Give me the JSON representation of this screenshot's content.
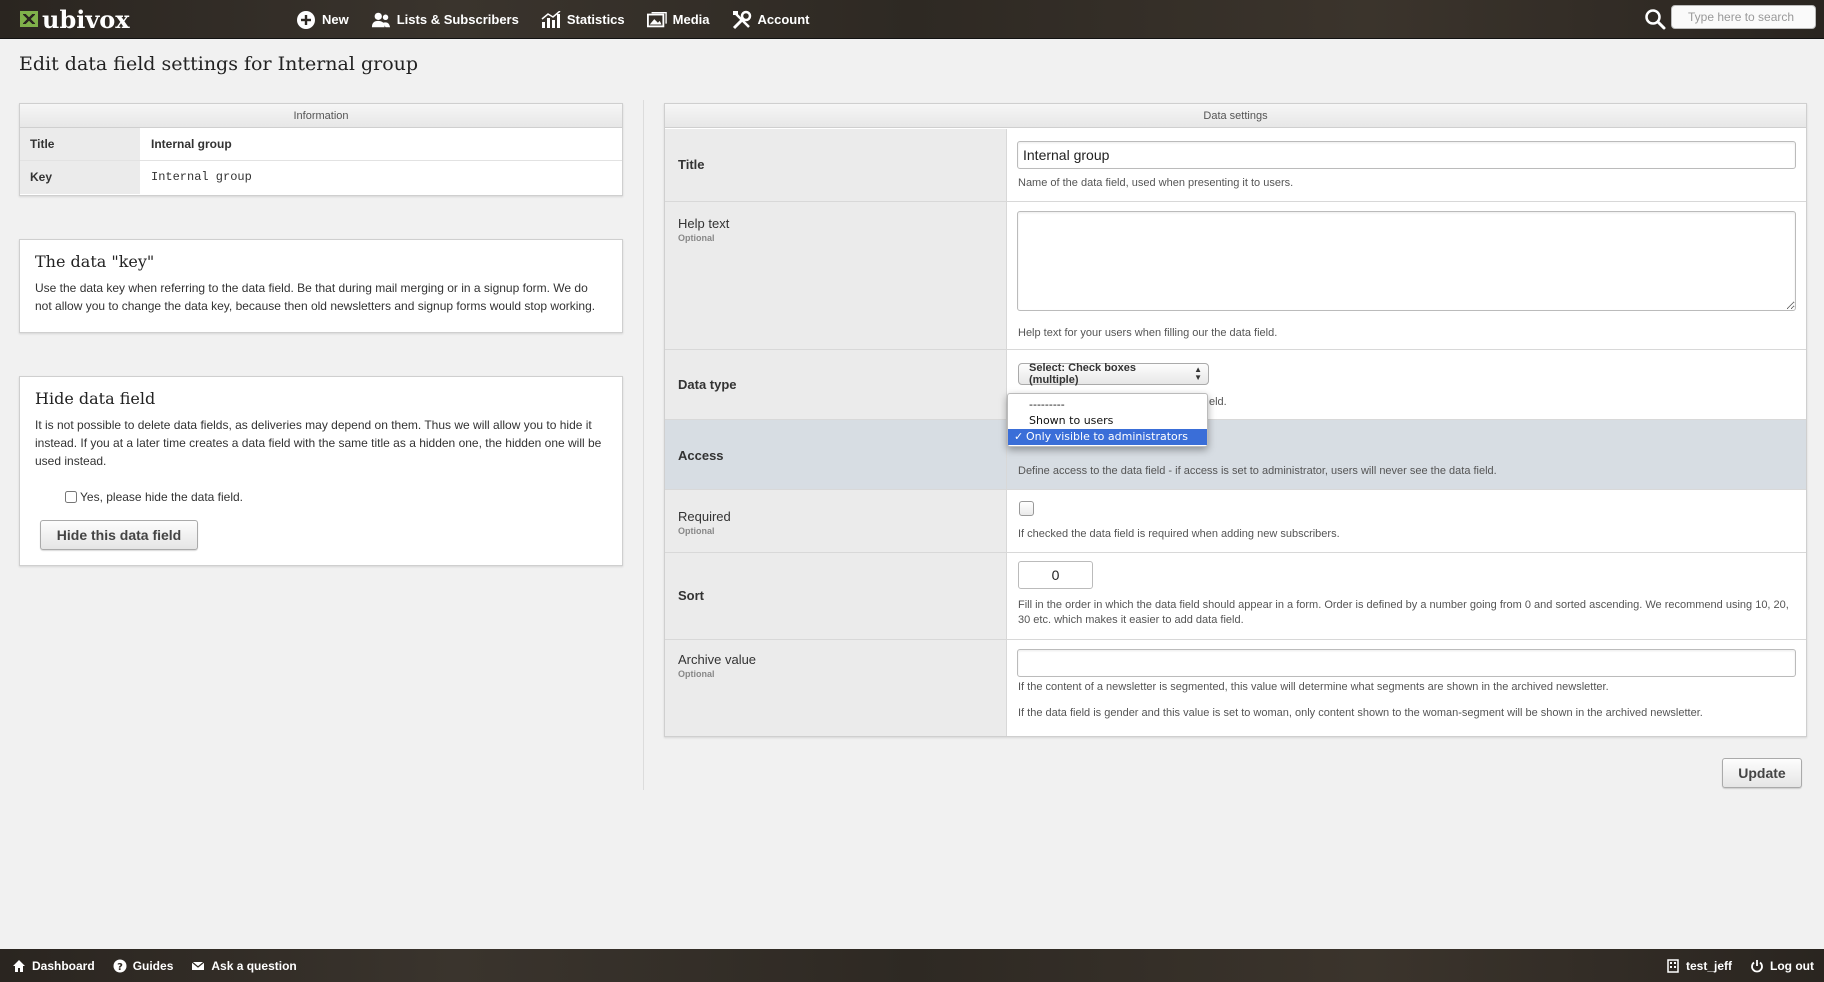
{
  "app": {
    "logo_text": "ubivox"
  },
  "nav": {
    "items": [
      {
        "label": "New",
        "icon": "plus-circle-icon"
      },
      {
        "label": "Lists & Subscribers",
        "icon": "users-icon"
      },
      {
        "label": "Statistics",
        "icon": "bar-chart-icon"
      },
      {
        "label": "Media",
        "icon": "image-icon"
      },
      {
        "label": "Account",
        "icon": "tools-icon"
      }
    ],
    "search_placeholder": "Type here to search"
  },
  "page_title": "Edit data field settings for Internal group",
  "information": {
    "heading": "Information",
    "rows": [
      {
        "key": "Title",
        "value": "Internal group"
      },
      {
        "key": "Key",
        "value": "Internal group"
      }
    ]
  },
  "data_key_box": {
    "title": "The data \"key\"",
    "text": "Use the data key when referring to the data field. Be that during mail merging or in a signup form. We do not allow you to change the data key, because then old newsletters and signup forms would stop working."
  },
  "hide_box": {
    "title": "Hide data field",
    "text": "It is not possible to delete data fields, as deliveries may depend on them. Thus we will allow you to hide it instead. If you at a later time creates a data field with the same title as a hidden one, the hidden one will be used instead.",
    "checkbox_label": "Yes, please hide the data field.",
    "checkbox_checked": false,
    "button_label": "Hide this data field"
  },
  "data_settings": {
    "heading": "Data settings",
    "title_label": "Title",
    "title_value": "Internal group",
    "title_help": "Name of the data field, used when presenting it to users.",
    "help_label": "Help text",
    "help_optional": "Optional",
    "help_value": "",
    "help_help": "Help text for your users when filling our the data field.",
    "type_label": "Data type",
    "type_value": "Select: Check boxes (multiple)",
    "type_help_visible_tail": "eld.",
    "access_label": "Access",
    "access_help": "Define access to the data field - if access is set to administrator, users will never see the data field.",
    "access_options": [
      "---------",
      "Shown to users",
      "Only visible to administrators"
    ],
    "access_selected": "Only visible to administrators",
    "access_check_glyph": "✓",
    "required_label": "Required",
    "required_optional": "Optional",
    "required_checked": false,
    "required_help": "If checked the data field is required when adding new subscribers.",
    "sort_label": "Sort",
    "sort_value": "0",
    "sort_help": "Fill in the order in which the data field should appear in a form. Order is defined by a number going from 0 and sorted ascending. We recommend using 10, 20, 30 etc. which makes it easier to add data field.",
    "archive_label": "Archive value",
    "archive_optional": "Optional",
    "archive_value": "",
    "archive_help_1": "If the content of a newsletter is segmented, this value will determine what segments are shown in the archived newsletter.",
    "archive_help_2": "If the data field is gender and this value is set to woman, only content shown to the woman-segment will be shown in the archived newsletter.",
    "update_label": "Update"
  },
  "footer": {
    "left": [
      {
        "label": "Dashboard",
        "icon": "home-icon"
      },
      {
        "label": "Guides",
        "icon": "help-circle-icon"
      },
      {
        "label": "Ask a question",
        "icon": "mail-icon"
      }
    ],
    "right": [
      {
        "label": "test_jeff",
        "icon": "building-icon"
      },
      {
        "label": "Log out",
        "icon": "power-icon"
      }
    ]
  },
  "colors": {
    "topbar": "#2e2923",
    "accent_green": "#7fb04a",
    "highlight_row": "#d7dde3",
    "dropdown_selected": "#3a6ed8"
  }
}
